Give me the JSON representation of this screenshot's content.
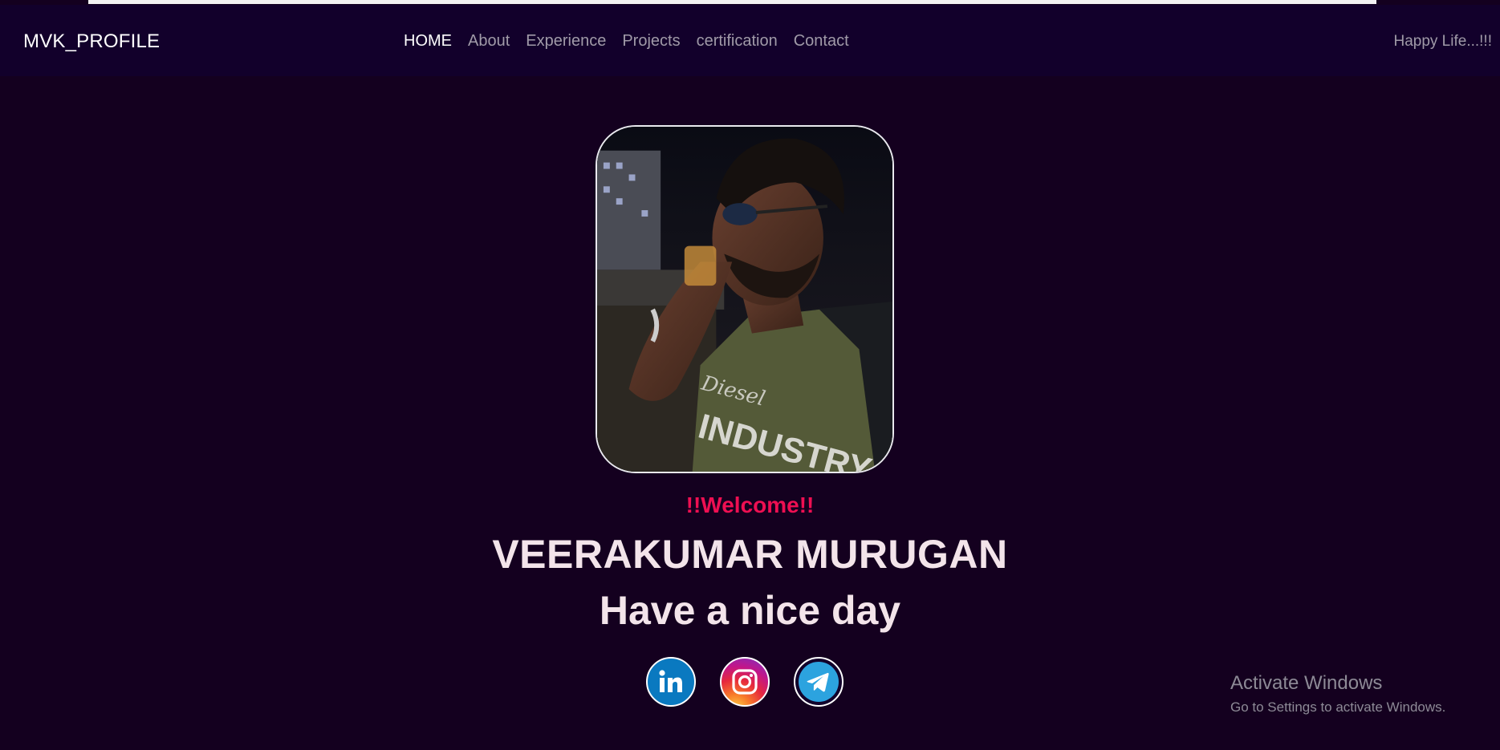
{
  "brand": "MVK_PROFILE",
  "nav": {
    "items": [
      "HOME",
      "About",
      "Experience",
      "Projects",
      "certification",
      "Contact"
    ],
    "active": "HOME"
  },
  "tagline": "Happy Life...!!!",
  "hero": {
    "welcome": "!!Welcome!!",
    "name": "VEERAKUMAR MURUGAN",
    "greeting": "Have a nice day"
  },
  "socials": [
    {
      "name": "LinkedIn",
      "icon": "linkedin-icon"
    },
    {
      "name": "Instagram",
      "icon": "instagram-icon"
    },
    {
      "name": "Telegram",
      "icon": "telegram-icon"
    }
  ],
  "watermark": {
    "title": "Activate Windows",
    "subtitle": "Go to Settings to activate Windows."
  },
  "colors": {
    "background": "#14001f",
    "navbar": "#12002b",
    "welcome": "#ee0f52",
    "heading": "#f3e4ea",
    "nav_inactive": "#a09aa8"
  }
}
